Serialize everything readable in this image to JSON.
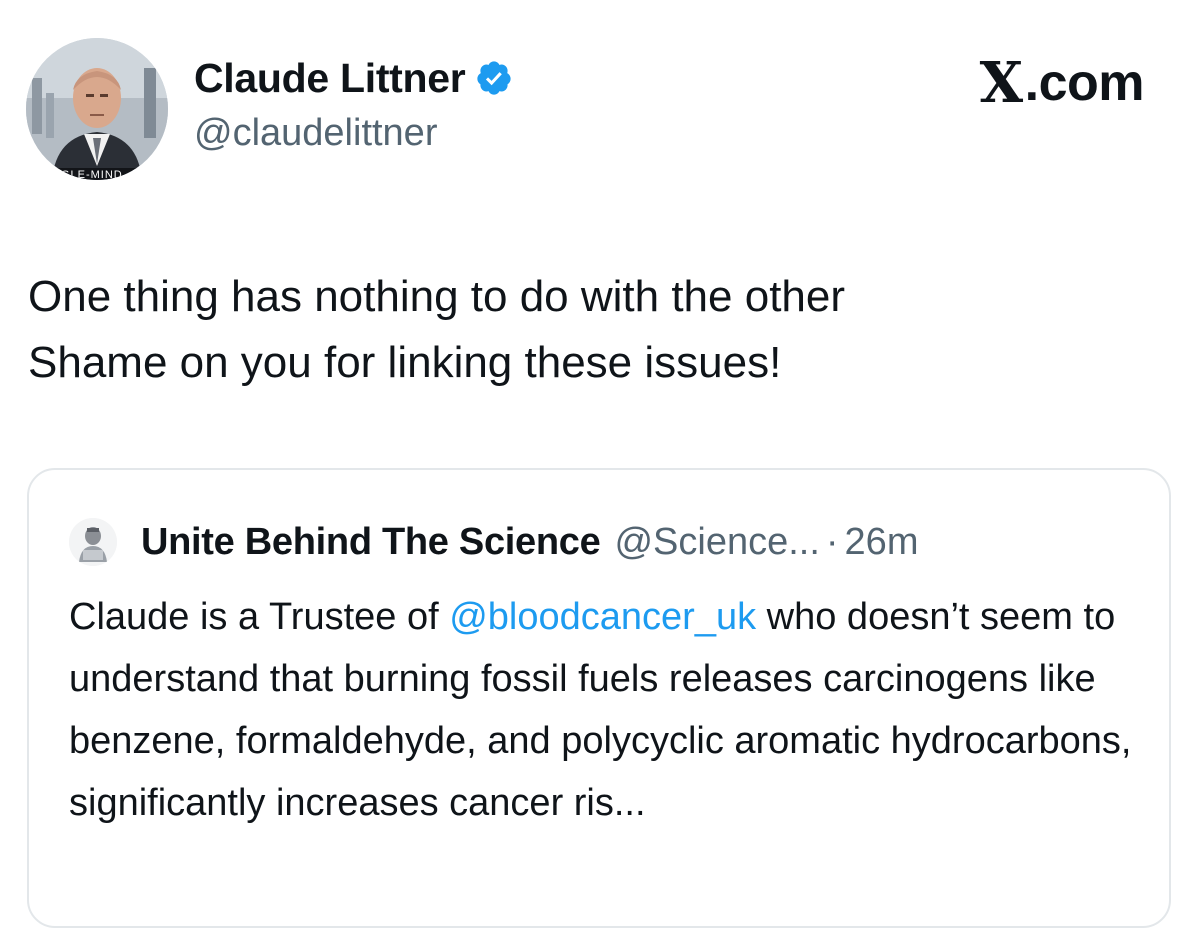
{
  "author": {
    "name": "Claude Littner",
    "handle": "@claudelittner",
    "verified": true,
    "avatar_ribbon_text": "NGLE-MIND"
  },
  "brand": {
    "logo_letter": "X",
    "logo_suffix": ".com"
  },
  "tweet": {
    "text": "One thing has nothing to do with the other\nShame on you for linking these issues!"
  },
  "quoted_tweet": {
    "author_name": "Unite Behind The Science",
    "author_handle": "@Science...",
    "separator": "·",
    "time": "26m",
    "text_before_mention": "Claude is a Trustee of ",
    "mention": "@bloodcancer_uk",
    "text_after_mention": " who doesn’t seem to understand that burning fossil fuels releases carcinogens like benzene, formaldehyde, and polycyclic aromatic hydrocarbons, significantly increases cancer ris..."
  },
  "colors": {
    "text_primary": "#0f1419",
    "text_secondary": "#536471",
    "link": "#1d9bf0",
    "verified_badge": "#1d9bf0",
    "card_border": "#e3e7ea"
  },
  "icons": {
    "verified": "verified-badge-icon",
    "brand": "x-logo-icon"
  }
}
